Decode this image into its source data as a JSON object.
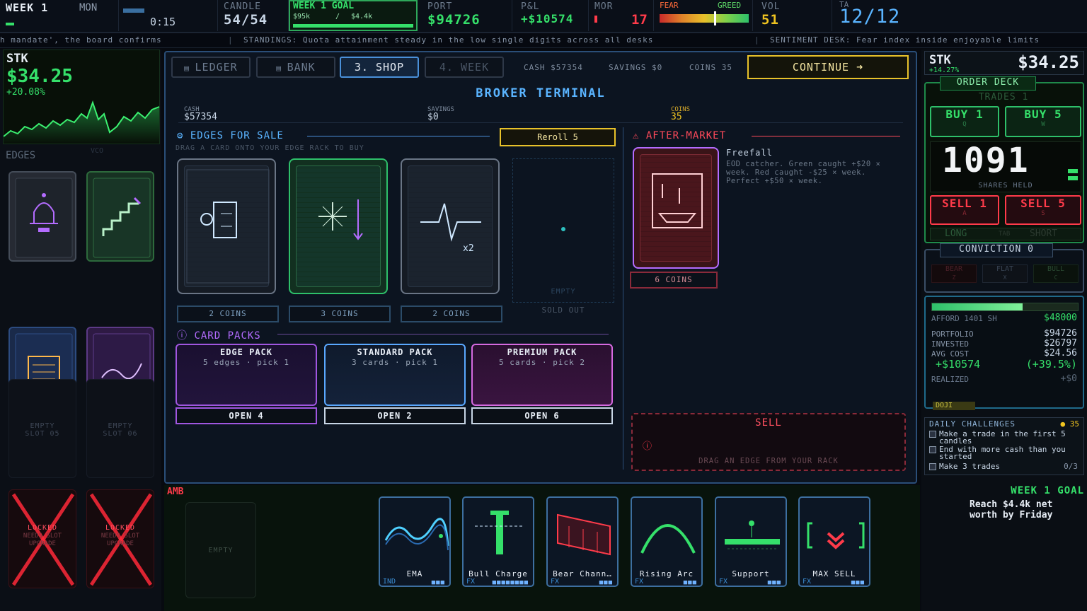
{
  "topbar": {
    "week": "WEEK 1",
    "day": "MON",
    "timer": "0:15",
    "candle_label": "CANDLE",
    "candle_value": "54/54",
    "goal_label": "WEEK 1 GOAL",
    "goal_current": "$95k",
    "goal_sep": "/",
    "goal_target": "$4.4k",
    "port_label": "PORT",
    "port_value": "$94726",
    "pnl_label": "P&L",
    "pnl_value": "+$10574",
    "mor_label": "MOR",
    "mor_value": "17",
    "fear_label": "FEAR",
    "greed_label": "GREED",
    "fear_greed_level": 0.62,
    "vol_label": "VOL",
    "vol_value": "51",
    "ta_label": "TA",
    "ta_value": "12/12"
  },
  "ticker": {
    "item1": "h mandate', the board confirms",
    "item2": "STANDINGS: Quota attainment steady in the low single digits across all desks",
    "item3": "SENTIMENT DESK: Fear index inside enjoyable limits"
  },
  "left": {
    "symbol": "STK",
    "price": "$34.25",
    "change": "+20.08%",
    "edges_label": "EDGES",
    "edges_label2": "VCO",
    "empty1": "EMPTY",
    "slot1": "SLOT 05",
    "empty2": "EMPTY",
    "slot2": "SLOT 06",
    "locked": "LOCKED",
    "needs": "NEEDS SLOT",
    "upgrade": "UPGRADE"
  },
  "nav": {
    "tab1": "LEDGER",
    "tab2": "BANK",
    "tab3": "3. SHOP",
    "tab4": "4. WEEK",
    "cash": "CASH $57354",
    "savings": "SAVINGS $0",
    "coins": "COINS 35",
    "continue": "CONTINUE"
  },
  "terminal": {
    "title": "BROKER TERMINAL",
    "cash_label": "CASH",
    "cash_value": "$57354",
    "savings_label": "SAVINGS",
    "savings_value": "$0",
    "coins_label": "COINS",
    "coins_value": "35"
  },
  "edges_sale": {
    "title": "EDGES FOR SALE",
    "hint": "DRAG A CARD ONTO YOUR EDGE RACK TO BUY",
    "reroll": "Reroll  5",
    "price1": "2 COINS",
    "price2": "3 COINS",
    "price3": "2 COINS",
    "empty": "EMPTY",
    "sold_out": "SOLD OUT",
    "card3_badge": "x2"
  },
  "after_market": {
    "title": "AFTER-MARKET",
    "name": "Freefall",
    "desc": "EOD catcher. Green caught +$20 × week. Red caught -$25 × week. Perfect +$50 × week.",
    "price": "6 COINS"
  },
  "packs": {
    "title": "CARD PACKS",
    "items": [
      {
        "name": "EDGE PACK",
        "sub": "5 edges · pick 1",
        "open": "OPEN  4"
      },
      {
        "name": "STANDARD PACK",
        "sub": "3 cards · pick 1",
        "open": "OPEN  2"
      },
      {
        "name": "PREMIUM PACK",
        "sub": "5 cards · pick 2",
        "open": "OPEN  6"
      }
    ]
  },
  "sell_zone": {
    "title": "SELL",
    "hint": "DRAG AN EDGE FROM YOUR RACK"
  },
  "right": {
    "symbol": "STK",
    "price": "$34.25",
    "change": "+14.27%",
    "order_deck": "ORDER DECK",
    "trades": "TRADES 1",
    "buy1": "BUY 1",
    "buy1_key": "Q",
    "buy5": "BUY 5",
    "buy5_key": "W",
    "shares": "1091",
    "shares_label": "SHARES HELD",
    "sell1": "SELL 1",
    "sell1_key": "A",
    "sell5": "SELL 5",
    "sell5_key": "S",
    "long": "LONG",
    "tab": "TAB",
    "short": "SHORT",
    "conviction": "CONVICTION 0",
    "bear": "BEAR",
    "bear_key": "Z",
    "flat": "FLAT",
    "flat_key": "X",
    "bull": "BULL",
    "bull_key": "C",
    "afford": "AFFORD 1401 SH",
    "afford_value": "$48000",
    "portfolio_label": "PORTFOLIO",
    "portfolio_value": "$94726",
    "invested_label": "INVESTED",
    "invested_value": "$26797",
    "avg_label": "AVG COST",
    "avg_value": "$24.56",
    "pnl_value": "+$10574",
    "pnl_pct": "(+39.5%)",
    "realized_label": "REALIZED",
    "realized_value": "+$0",
    "doji": "DOJI",
    "challenges_title": "DAILY CHALLENGES",
    "challenges_coins": "35",
    "ch1": "Make a trade in the first 5 candles",
    "ch2": "End with more cash than you started",
    "ch3": "Make 3 trades",
    "ch3_progress": "0/3"
  },
  "bottom": {
    "amb": "AMB",
    "empty": "EMPTY",
    "goal_title": "WEEK 1 GOAL",
    "goal_text": "Reach $4.4k net worth by Friday",
    "hand": [
      {
        "name": "EMA",
        "type": "IND"
      },
      {
        "name": "Bull Charge",
        "type": "FX"
      },
      {
        "name": "Bear Chann…",
        "type": "FX"
      },
      {
        "name": "Rising Arc",
        "type": "FX"
      },
      {
        "name": "Support",
        "type": "FX"
      },
      {
        "name": "MAX SELL",
        "type": "FX"
      }
    ]
  },
  "colors": {
    "accent_blue": "#3aa0ff",
    "green": "#35e06a",
    "red": "#ff3b4a",
    "yellow": "#f0c420",
    "purple": "#b46cff"
  }
}
